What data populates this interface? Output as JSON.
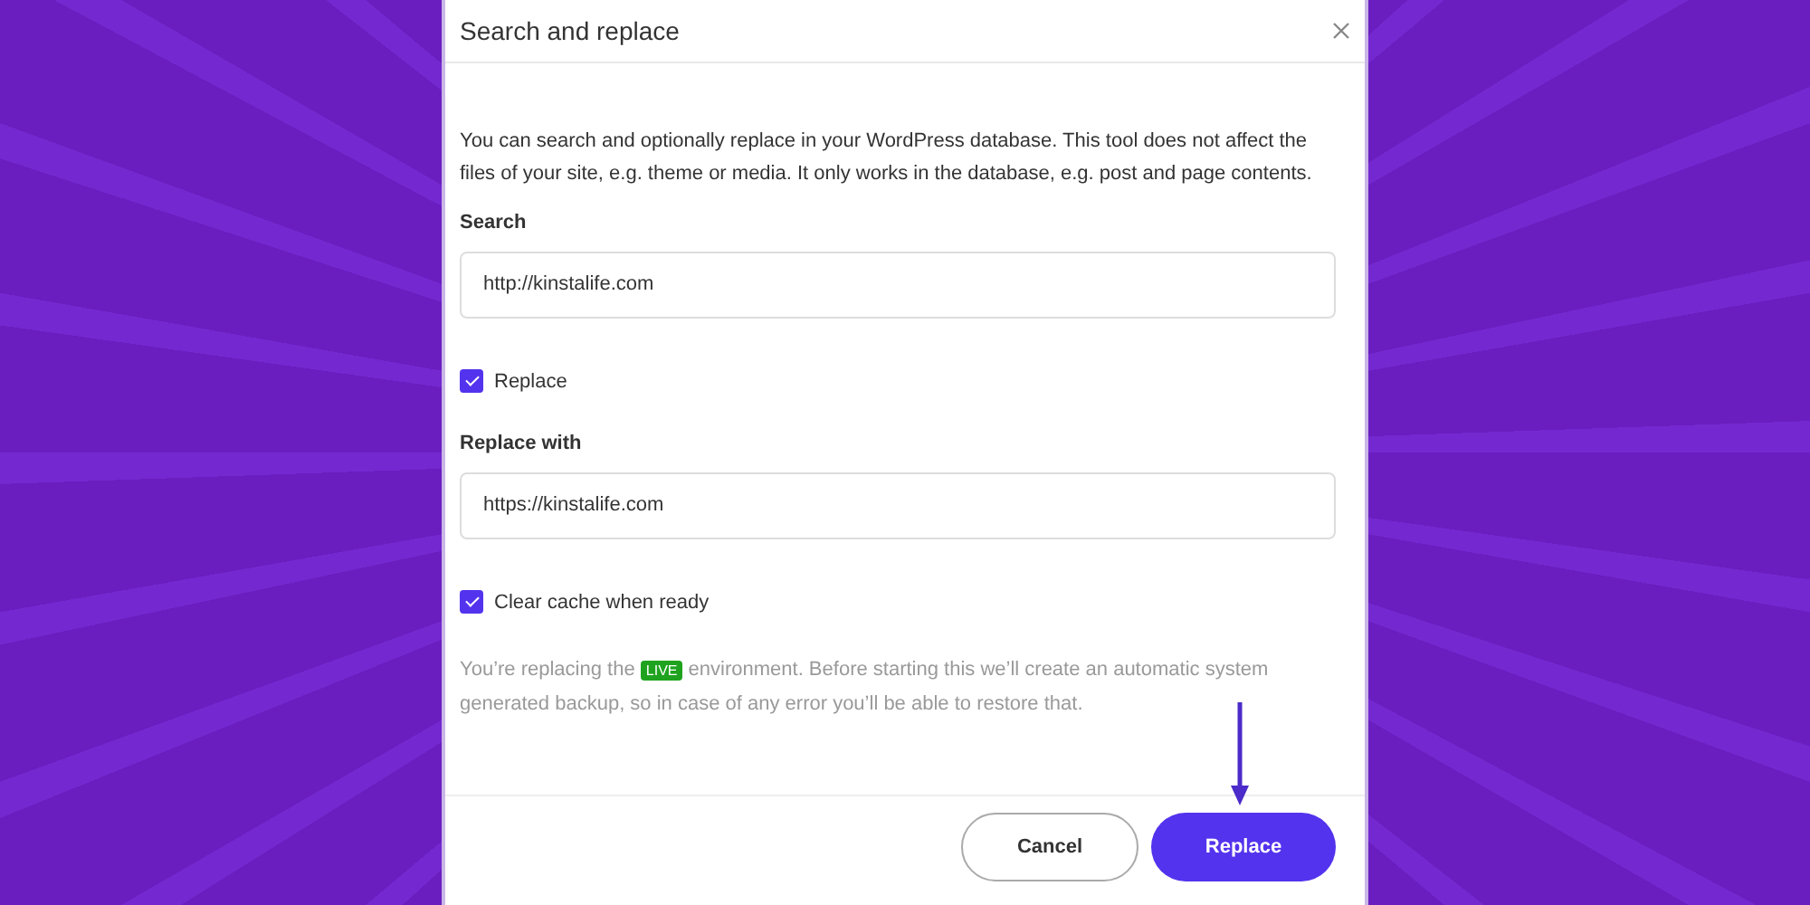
{
  "dialog": {
    "title": "Search and replace"
  },
  "description": "You can search and optionally replace in your WordPress database. This tool does not affect the files of your site, e.g. theme or media. It only works in the database, e.g. post and page contents.",
  "search": {
    "label": "Search",
    "value": "http://kinstalife.com"
  },
  "replace_toggle": {
    "label": "Replace",
    "checked": true
  },
  "replace_with": {
    "label": "Replace with",
    "value": "https://kinstalife.com"
  },
  "clear_cache": {
    "label": "Clear cache when ready",
    "checked": true
  },
  "notice": {
    "before": "You’re replacing the",
    "badge": "LIVE",
    "after": "environment. Before starting this we’ll create an automatic system generated backup, so in case of any error you’ll be able to restore that."
  },
  "buttons": [
    {
      "label": "Cancel",
      "kind": "secondary"
    },
    {
      "label": "Replace",
      "kind": "primary"
    }
  ]
}
